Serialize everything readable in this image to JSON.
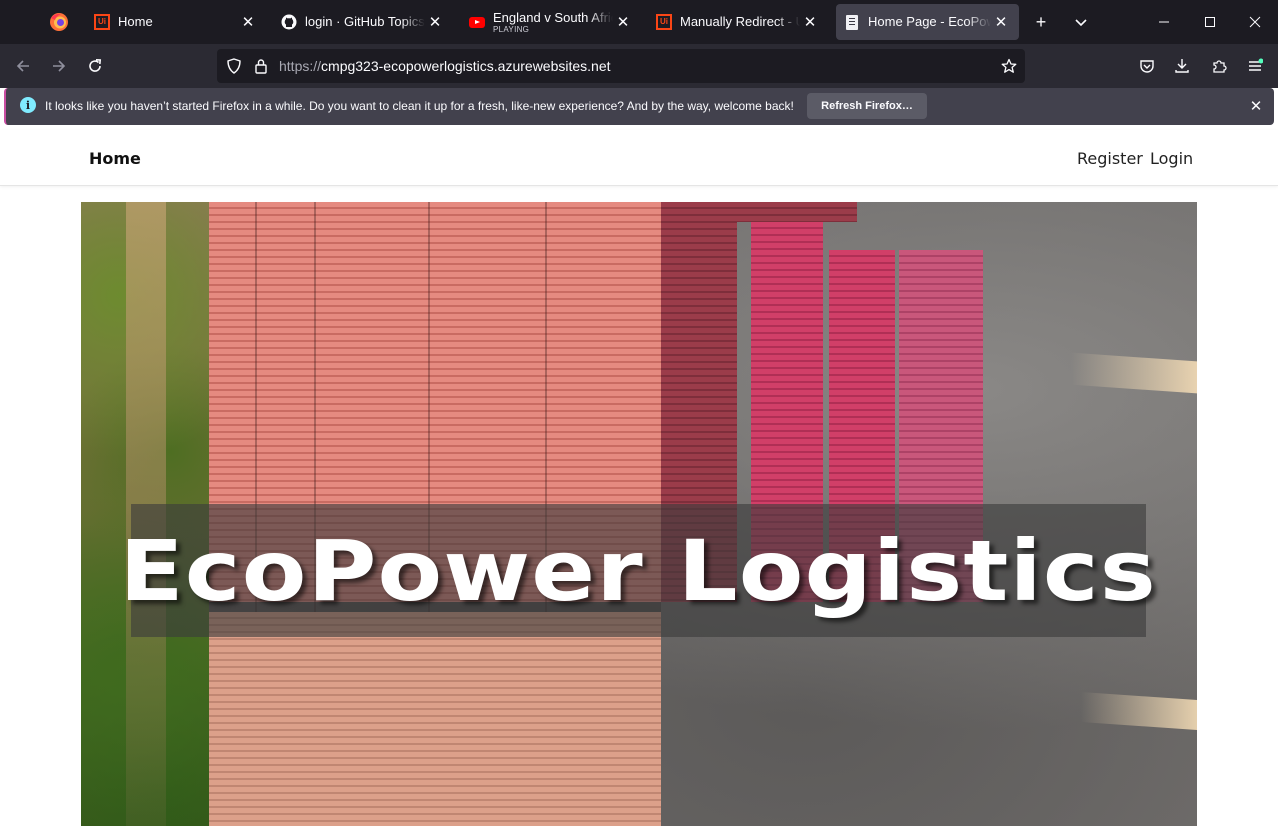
{
  "browser": {
    "tabs": [
      {
        "title": "Home",
        "subtitle": "",
        "icon": "uipath-icon",
        "active": false
      },
      {
        "title": "login · GitHub Topics · Gi",
        "subtitle": "",
        "icon": "github-icon",
        "active": false
      },
      {
        "title": "England v South Africa |",
        "subtitle": "PLAYING",
        "icon": "youtube-icon",
        "active": false
      },
      {
        "title": "Manually Redirect - UiPa",
        "subtitle": "",
        "icon": "uipath-icon",
        "active": false
      },
      {
        "title": "Home Page - EcoPower_",
        "subtitle": "",
        "icon": "page-icon",
        "active": true
      }
    ],
    "tab_icon_text": "Ui",
    "url_scheme": "https://",
    "url_host": "cmpg323-ecopowerlogistics.azurewebsites.net",
    "notification": {
      "message": "It looks like you haven’t started Firefox in a while. Do you want to clean it up for a fresh, like-new experience? And by the way, welcome back!",
      "button_label": "Refresh Firefox…",
      "info_glyph": "i"
    },
    "colors": {
      "tabstrip": "#1c1b22",
      "toolbar": "#2b2a33",
      "active_tab": "#42414d",
      "notif_accent": "#c94ea2"
    }
  },
  "site": {
    "brand": "Home",
    "nav": {
      "register": "Register",
      "login": "Login"
    },
    "hero_title": "EcoPower Logistics"
  }
}
